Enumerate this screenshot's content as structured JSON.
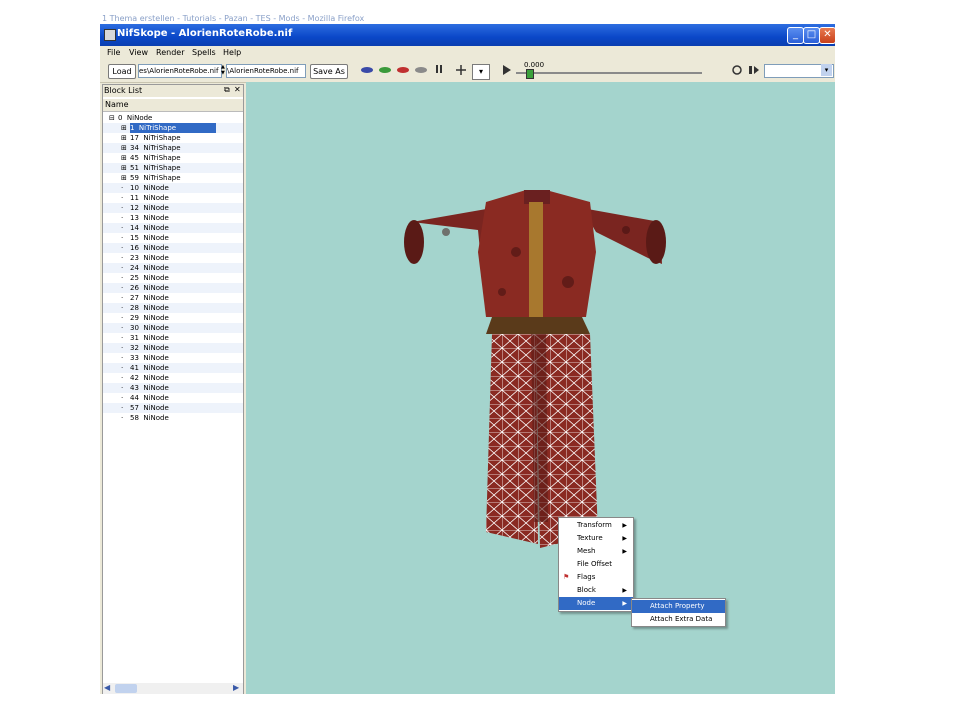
{
  "background_window": {
    "title": "1 Thema erstellen - Tutorials - Pazan - TES - Mods - Mozilla Firefox"
  },
  "window": {
    "title": "NifSkope - AlorienRoteRobe.nif",
    "controls": {
      "minimize": "_",
      "maximize": "□",
      "close": "✕"
    }
  },
  "menubar": {
    "items": [
      "File",
      "View",
      "Render",
      "Spells",
      "Help"
    ]
  },
  "toolbar": {
    "load_label": "Load",
    "load_path": "es\\AlorienRoteRobe.nif",
    "save_path": "\\AlorienRoteRobe.nif",
    "save_as_label": "Save As",
    "time_value": "0.000",
    "animation_select_value": "",
    "play_progress": 0.0
  },
  "blocklist": {
    "title": "Block List",
    "column_header": "Name",
    "rows": [
      {
        "id": "0",
        "name": "NiNode",
        "expander": "⊟",
        "selected": false
      },
      {
        "id": "1",
        "name": "NiTriShape",
        "expander": "⊞",
        "selected": true
      },
      {
        "id": "17",
        "name": "NiTriShape",
        "expander": "⊞",
        "selected": false
      },
      {
        "id": "34",
        "name": "NiTriShape",
        "expander": "⊞",
        "selected": false
      },
      {
        "id": "45",
        "name": "NiTriShape",
        "expander": "⊞",
        "selected": false
      },
      {
        "id": "51",
        "name": "NiTriShape",
        "expander": "⊞",
        "selected": false
      },
      {
        "id": "59",
        "name": "NiTriShape",
        "expander": "⊞",
        "selected": false
      },
      {
        "id": "10",
        "name": "NiNode",
        "expander": "",
        "selected": false
      },
      {
        "id": "11",
        "name": "NiNode",
        "expander": "",
        "selected": false
      },
      {
        "id": "12",
        "name": "NiNode",
        "expander": "",
        "selected": false
      },
      {
        "id": "13",
        "name": "NiNode",
        "expander": "",
        "selected": false
      },
      {
        "id": "14",
        "name": "NiNode",
        "expander": "",
        "selected": false
      },
      {
        "id": "15",
        "name": "NiNode",
        "expander": "",
        "selected": false
      },
      {
        "id": "16",
        "name": "NiNode",
        "expander": "",
        "selected": false
      },
      {
        "id": "23",
        "name": "NiNode",
        "expander": "",
        "selected": false
      },
      {
        "id": "24",
        "name": "NiNode",
        "expander": "",
        "selected": false
      },
      {
        "id": "25",
        "name": "NiNode",
        "expander": "",
        "selected": false
      },
      {
        "id": "26",
        "name": "NiNode",
        "expander": "",
        "selected": false
      },
      {
        "id": "27",
        "name": "NiNode",
        "expander": "",
        "selected": false
      },
      {
        "id": "28",
        "name": "NiNode",
        "expander": "",
        "selected": false
      },
      {
        "id": "29",
        "name": "NiNode",
        "expander": "",
        "selected": false
      },
      {
        "id": "30",
        "name": "NiNode",
        "expander": "",
        "selected": false
      },
      {
        "id": "31",
        "name": "NiNode",
        "expander": "",
        "selected": false
      },
      {
        "id": "32",
        "name": "NiNode",
        "expander": "",
        "selected": false
      },
      {
        "id": "33",
        "name": "NiNode",
        "expander": "",
        "selected": false
      },
      {
        "id": "41",
        "name": "NiNode",
        "expander": "",
        "selected": false
      },
      {
        "id": "42",
        "name": "NiNode",
        "expander": "",
        "selected": false
      },
      {
        "id": "43",
        "name": "NiNode",
        "expander": "",
        "selected": false
      },
      {
        "id": "44",
        "name": "NiNode",
        "expander": "",
        "selected": false
      },
      {
        "id": "57",
        "name": "NiNode",
        "expander": "",
        "selected": false
      },
      {
        "id": "58",
        "name": "NiNode",
        "expander": "",
        "selected": false
      }
    ]
  },
  "context_menu": {
    "items": [
      {
        "label": "Transform",
        "submenu": true,
        "highlighted": false,
        "icon": ""
      },
      {
        "label": "Texture",
        "submenu": true,
        "highlighted": false,
        "icon": ""
      },
      {
        "label": "Mesh",
        "submenu": true,
        "highlighted": false,
        "icon": ""
      },
      {
        "label": "File Offset",
        "submenu": false,
        "highlighted": false,
        "icon": ""
      },
      {
        "label": "Flags",
        "submenu": false,
        "highlighted": false,
        "icon": "flag-icon"
      },
      {
        "label": "Block",
        "submenu": true,
        "highlighted": false,
        "icon": ""
      },
      {
        "label": "Node",
        "submenu": true,
        "highlighted": true,
        "icon": ""
      }
    ],
    "submenu": [
      {
        "label": "Attach Property",
        "highlighted": true
      },
      {
        "label": "Attach Extra Data",
        "highlighted": false
      }
    ]
  },
  "colors": {
    "viewport_bg": "#a4d4cd",
    "selection": "#316ac5",
    "robe_main": "#8a2a22",
    "robe_trim": "#a8782e"
  }
}
